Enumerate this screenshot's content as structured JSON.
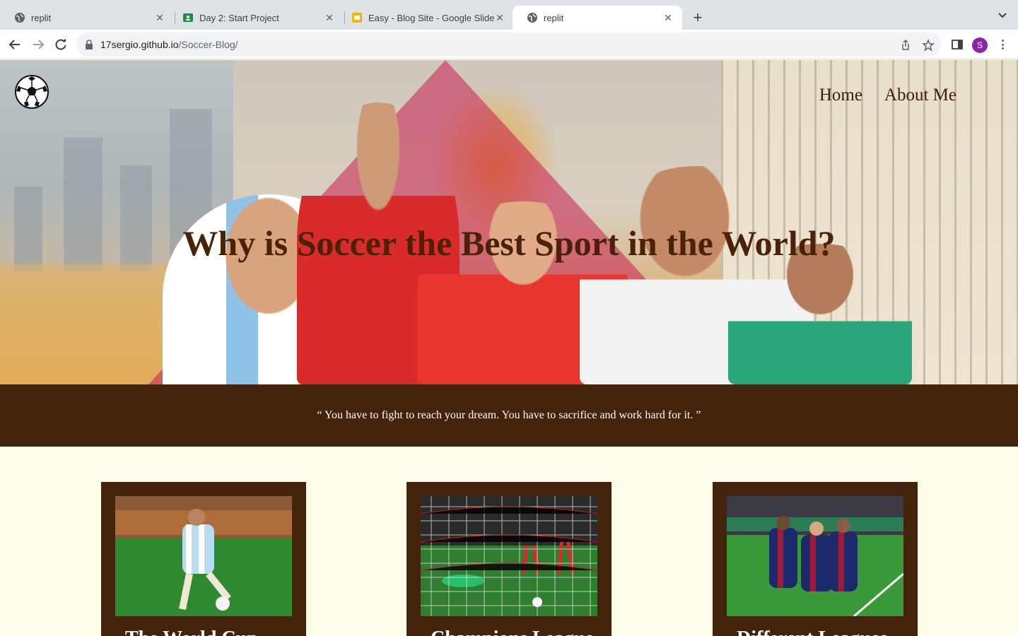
{
  "browser": {
    "tabs": [
      {
        "title": "replit",
        "icon": "globe-icon"
      },
      {
        "title": "Day 2: Start Project",
        "icon": "classroom-icon"
      },
      {
        "title": "Easy - Blog Site - Google Slides",
        "icon": "slides-icon"
      },
      {
        "title": "replit",
        "icon": "globe-icon"
      }
    ],
    "active_tab": 3,
    "url_host": "17sergio.github.io",
    "url_path": "/Soccer-Blog/",
    "profile_initial": "S",
    "profile_color": "#8e24aa"
  },
  "site": {
    "logo_icon": "soccer-ball-icon",
    "nav": [
      "Home",
      "About Me"
    ],
    "hero_title": "Why is Soccer the Best Sport in the World?",
    "quote": "“ You have to fight to reach your dream. You have to sacrifice and work hard for it. ”",
    "colors": {
      "brown": "#43230c",
      "cream": "#fdfde9",
      "title": "#4a2208"
    },
    "cards": [
      {
        "title": "The World Cup",
        "image": "player-striking-ball-photo"
      },
      {
        "title": "Champions League",
        "image": "goalkeeper-diving-net-photo"
      },
      {
        "title": "Different Leagues",
        "image": "players-celebrating-photo"
      }
    ]
  }
}
